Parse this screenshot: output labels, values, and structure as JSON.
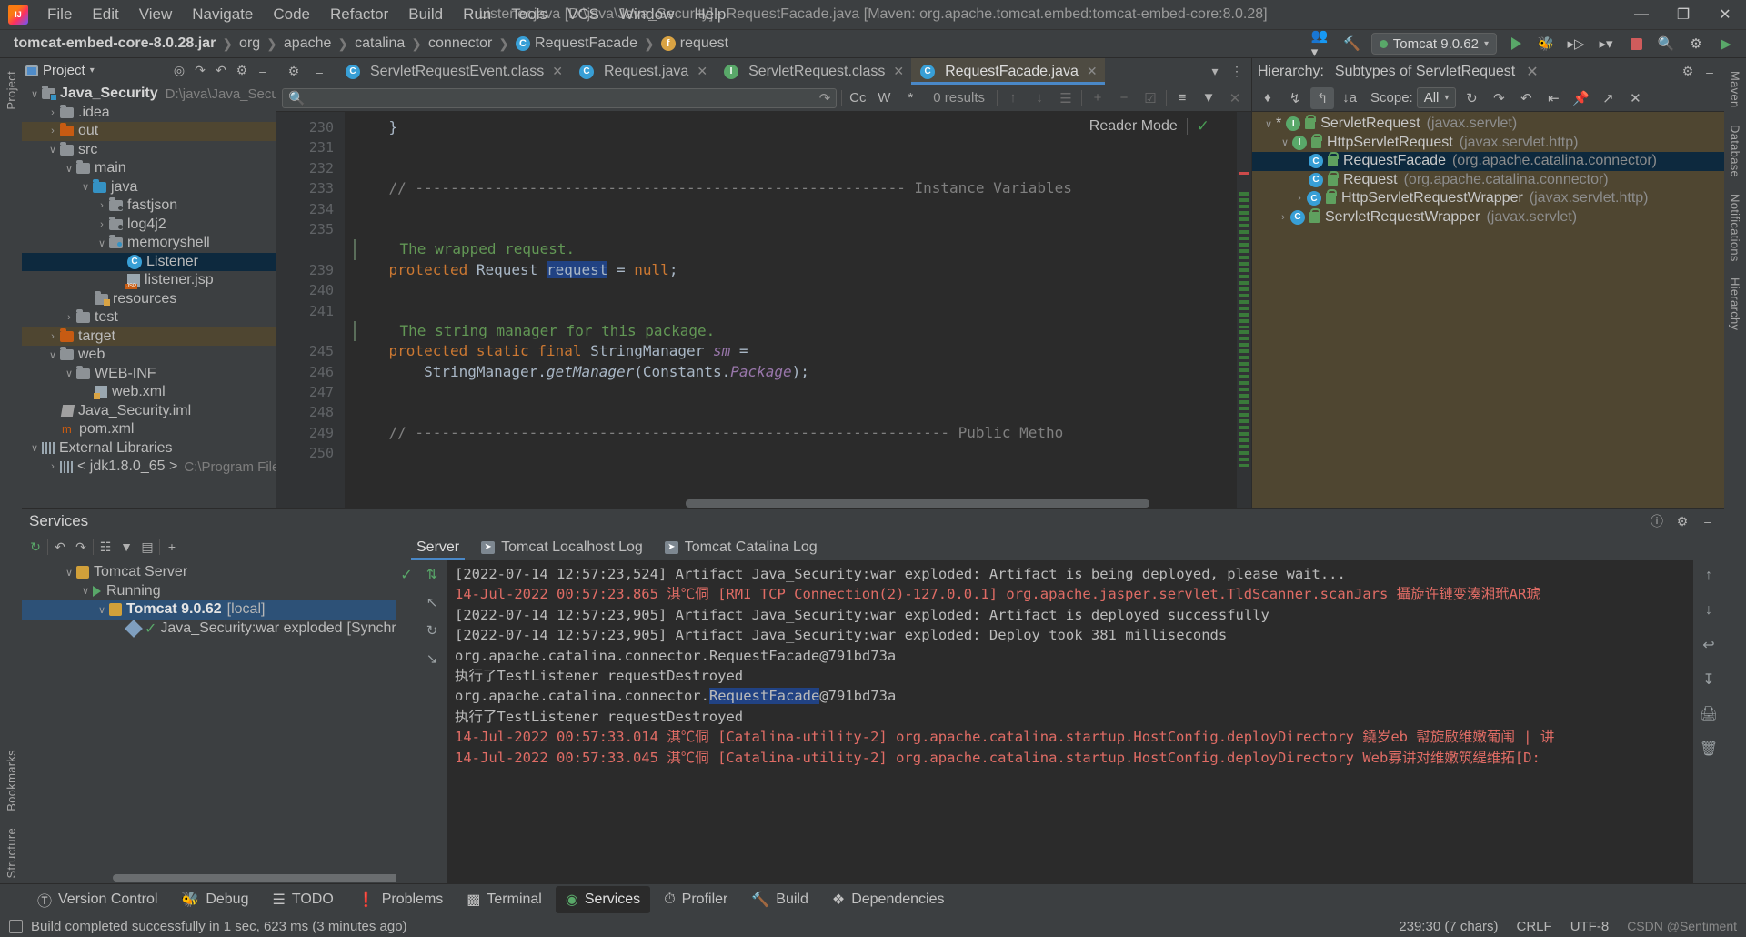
{
  "window": {
    "title": "Listener.java [D:\\java\\Java_Security] - RequestFacade.java [Maven: org.apache.tomcat.embed:tomcat-embed-core:8.0.28]",
    "menu": [
      "File",
      "Edit",
      "View",
      "Navigate",
      "Code",
      "Refactor",
      "Build",
      "Run",
      "Tools",
      "VCS",
      "Window",
      "Help"
    ],
    "controls": {
      "minimize": "—",
      "maximize": "❐",
      "close": "✕"
    },
    "logo": "intellij-idea-logo"
  },
  "navbar": {
    "crumbs": [
      {
        "label": "tomcat-embed-core-8.0.28.jar",
        "icon": "",
        "bold": true
      },
      {
        "label": "org",
        "icon": ""
      },
      {
        "label": "apache",
        "icon": ""
      },
      {
        "label": "catalina",
        "icon": ""
      },
      {
        "label": "connector",
        "icon": ""
      },
      {
        "label": "RequestFacade",
        "icon": "C"
      },
      {
        "label": "request",
        "icon": "f"
      }
    ],
    "run_config": "Tomcat 9.0.62",
    "icons": [
      "user-group-icon",
      "hammer-build-icon",
      "run-icon",
      "debug-icon",
      "run-with-coverage-icon",
      "profiler-icon",
      "stop-icon",
      "search-icon",
      "settings-icon",
      "updates-icon"
    ]
  },
  "project_panel": {
    "title": "Project",
    "toolbar_icons": [
      "locate-icon",
      "expand-all-icon",
      "collapse-all-icon",
      "settings-icon",
      "hide-icon"
    ],
    "tree": [
      {
        "depth": 0,
        "arrow": "∨",
        "icon": "module-folder",
        "label": "Java_Security",
        "bold": true,
        "path": "D:\\java\\Java_Security"
      },
      {
        "depth": 1,
        "arrow": "›",
        "icon": "folder",
        "label": ".idea"
      },
      {
        "depth": 1,
        "arrow": "›",
        "icon": "folder-orange",
        "label": "out",
        "highlight": "excluded"
      },
      {
        "depth": 1,
        "arrow": "∨",
        "icon": "folder",
        "label": "src"
      },
      {
        "depth": 2,
        "arrow": "∨",
        "icon": "folder",
        "label": "main"
      },
      {
        "depth": 3,
        "arrow": "∨",
        "icon": "folder-source",
        "label": "java"
      },
      {
        "depth": 4,
        "arrow": "›",
        "icon": "package",
        "label": "fastjson"
      },
      {
        "depth": 4,
        "arrow": "›",
        "icon": "package",
        "label": "log4j2"
      },
      {
        "depth": 4,
        "arrow": "∨",
        "icon": "package",
        "label": "memoryshell"
      },
      {
        "depth": 5,
        "arrow": "",
        "icon": "class",
        "label": "Listener",
        "selected": true
      },
      {
        "depth": 5,
        "arrow": "",
        "icon": "jsp",
        "label": "listener.jsp"
      },
      {
        "depth": 3,
        "arrow": "",
        "icon": "folder-resources",
        "label": "resources"
      },
      {
        "depth": 2,
        "arrow": "›",
        "icon": "folder",
        "label": "test"
      },
      {
        "depth": 1,
        "arrow": "›",
        "icon": "folder-orange",
        "label": "target",
        "highlight": "excluded"
      },
      {
        "depth": 1,
        "arrow": "∨",
        "icon": "folder",
        "label": "web"
      },
      {
        "depth": 2,
        "arrow": "∨",
        "icon": "folder",
        "label": "WEB-INF"
      },
      {
        "depth": 3,
        "arrow": "",
        "icon": "xml",
        "label": "web.xml"
      },
      {
        "depth": 1,
        "arrow": "",
        "icon": "iml",
        "label": "Java_Security.iml"
      },
      {
        "depth": 1,
        "arrow": "",
        "icon": "maven",
        "label": "pom.xml"
      },
      {
        "depth": 0,
        "arrow": "∨",
        "icon": "libraries",
        "label": "External Libraries"
      },
      {
        "depth": 1,
        "arrow": "›",
        "icon": "jdk",
        "label": "< jdk1.8.0_65 >",
        "path": "C:\\Program Files\\Jav"
      }
    ]
  },
  "editor": {
    "tabs": [
      {
        "label": "ServletRequestEvent.class",
        "icon": "C",
        "kind": "class",
        "active": false
      },
      {
        "label": "Request.java",
        "icon": "C",
        "kind": "class",
        "active": false
      },
      {
        "label": "ServletRequest.class",
        "icon": "I",
        "kind": "interface",
        "active": false
      },
      {
        "label": "RequestFacade.java",
        "icon": "C",
        "kind": "class",
        "active": true
      }
    ],
    "tab_extra_icons": [
      "chevron-down-icon",
      "more-vertical-icon"
    ],
    "findbar": {
      "placeholder": "",
      "results": "0 results",
      "options": [
        "Cc",
        "W",
        "*"
      ],
      "icons": [
        "search-icon",
        "history-icon",
        "match-case-icon",
        "words-icon",
        "regex-icon",
        "prev-icon",
        "next-icon",
        "select-all-icon",
        "add-icon",
        "remove-icon",
        "toggle-icon",
        "filter-lines-icon",
        "filter-icon",
        "close-icon"
      ]
    },
    "reader_mode": "Reader Mode",
    "lines": [
      {
        "num": "230",
        "segments": [
          {
            "t": "    }",
            "c": "plain"
          }
        ]
      },
      {
        "num": "231",
        "segments": []
      },
      {
        "num": "232",
        "segments": []
      },
      {
        "num": "233",
        "segments": [
          {
            "t": "    // -------------------------------------------------------- Instance Variables",
            "c": "cmt"
          }
        ]
      },
      {
        "num": "234",
        "segments": []
      },
      {
        "num": "235",
        "segments": []
      },
      {
        "num": "",
        "segments": [
          {
            "t": "    The wrapped request.",
            "c": "doc"
          }
        ],
        "docbar": true
      },
      {
        "num": "239",
        "segments": [
          {
            "t": "    ",
            "c": "plain"
          },
          {
            "t": "protected",
            "c": "kw"
          },
          {
            "t": " Request ",
            "c": "plain"
          },
          {
            "t": "request",
            "c": "selfield"
          },
          {
            "t": " = ",
            "c": "plain"
          },
          {
            "t": "null",
            "c": "kw"
          },
          {
            "t": ";",
            "c": "plain"
          }
        ]
      },
      {
        "num": "240",
        "segments": []
      },
      {
        "num": "241",
        "segments": []
      },
      {
        "num": "",
        "segments": [
          {
            "t": "    The string manager for this package.",
            "c": "doc"
          }
        ],
        "docbar": true
      },
      {
        "num": "245",
        "segments": [
          {
            "t": "    ",
            "c": "plain"
          },
          {
            "t": "protected static final",
            "c": "kw"
          },
          {
            "t": " StringManager ",
            "c": "plain"
          },
          {
            "t": "sm",
            "c": "sfld"
          },
          {
            "t": " =",
            "c": "plain"
          }
        ]
      },
      {
        "num": "246",
        "segments": [
          {
            "t": "        StringManager.",
            "c": "plain"
          },
          {
            "t": "getManager",
            "c": "static"
          },
          {
            "t": "(Constants.",
            "c": "plain"
          },
          {
            "t": "Package",
            "c": "sfld"
          },
          {
            "t": ");",
            "c": "plain"
          }
        ]
      },
      {
        "num": "247",
        "segments": []
      },
      {
        "num": "248",
        "segments": []
      },
      {
        "num": "249",
        "segments": [
          {
            "t": "    // ------------------------------------------------------------- Public Metho",
            "c": "cmt"
          }
        ]
      },
      {
        "num": "250",
        "segments": []
      }
    ]
  },
  "hierarchy": {
    "label": "Hierarchy:",
    "subtitle": "Subtypes of ServletRequest",
    "scope_label": "Scope:",
    "scope_value": "All",
    "toolbar_icons": [
      "supertypes-icon",
      "subtypes-icon",
      "class-hierarchy-icon",
      "sort-alpha-icon",
      "refresh-icon",
      "expand-all-icon",
      "collapse-all-icon",
      "export-icon",
      "pin-icon",
      "open-in-editor-icon",
      "close-icon"
    ],
    "head_icons": [
      "settings-icon",
      "hide-icon"
    ],
    "tree": [
      {
        "depth": 0,
        "arrow": "∨",
        "star": true,
        "kind": "I",
        "name": "ServletRequest",
        "pkg": "(javax.servlet)"
      },
      {
        "depth": 1,
        "arrow": "∨",
        "star": false,
        "kind": "I",
        "name": "HttpServletRequest",
        "pkg": "(javax.servlet.http)"
      },
      {
        "depth": 2,
        "arrow": "",
        "star": false,
        "kind": "C",
        "name": "RequestFacade",
        "pkg": "(org.apache.catalina.connector)",
        "selected": true
      },
      {
        "depth": 2,
        "arrow": "",
        "star": false,
        "kind": "C",
        "name": "Request",
        "pkg": "(org.apache.catalina.connector)"
      },
      {
        "depth": 1,
        "arrow": "›",
        "star": false,
        "kind": "C",
        "name": "HttpServletRequestWrapper",
        "pkg": "(javax.servlet.http)"
      },
      {
        "depth": 0,
        "arrow": "›",
        "star": false,
        "kind": "C",
        "name": "ServletRequestWrapper",
        "pkg": "(javax.servlet)"
      }
    ]
  },
  "services": {
    "title": "Services",
    "head_icons": [
      "help-icon",
      "settings-icon",
      "hide-icon"
    ],
    "toolbar_icons": [
      "rerun-icon",
      "collapse-all-icon",
      "expand-all-icon",
      "group-icon",
      "filter-icon",
      "show-icon",
      "add-icon"
    ],
    "tree": [
      {
        "depth": 0,
        "arrow": "∨",
        "icon": "tomcat-server",
        "label": "Tomcat Server"
      },
      {
        "depth": 1,
        "arrow": "∨",
        "icon": "running",
        "label": "Running"
      },
      {
        "depth": 2,
        "arrow": "∨",
        "icon": "tomcat",
        "label": "Tomcat 9.0.62",
        "suffix": "[local]",
        "selected": true,
        "bold": true
      },
      {
        "depth": 3,
        "arrow": "",
        "icon": "war",
        "label": "Java_Security:war exploded",
        "suffix": "[Synchronized"
      }
    ],
    "tabs": [
      {
        "label": "Server",
        "icon": "",
        "active": true
      },
      {
        "label": "Tomcat Localhost Log",
        "icon": "log",
        "active": false
      },
      {
        "label": "Tomcat Catalina Log",
        "icon": "log",
        "active": false
      }
    ],
    "console_tools": [
      "rerun-icon",
      "scroll-to-end-icon",
      "up-icon",
      "restart-icon",
      "down-icon"
    ],
    "console_right_tools": [
      "scroll-up-icon",
      "scroll-down-icon",
      "soft-wrap-icon",
      "scroll-to-end-icon",
      "print-icon",
      "clear-all-icon"
    ],
    "console_lines": [
      {
        "text": "[2022-07-14 12:57:23,524] Artifact Java_Security:war exploded: Artifact is being deployed, please wait...",
        "err": false
      },
      {
        "text": "14-Jul-2022 00:57:23.865 淇℃侗 [RMI TCP Connection(2)-127.0.0.1] org.apache.jasper.servlet.TldScanner.scanJars 攝旋许鏈变湊湘玳AR琥",
        "err": true
      },
      {
        "text": "[2022-07-14 12:57:23,905] Artifact Java_Security:war exploded: Artifact is deployed successfully",
        "err": false
      },
      {
        "text": "[2022-07-14 12:57:23,905] Artifact Java_Security:war exploded: Deploy took 381 milliseconds",
        "err": false
      },
      {
        "text": "org.apache.catalina.connector.RequestFacade@791bd73a",
        "err": false
      },
      {
        "text": "执行了TestListener requestDestroyed",
        "err": false
      },
      {
        "text": "org.apache.catalina.connector.RequestFacade@791bd73a",
        "err": false,
        "highlight": "RequestFacade"
      },
      {
        "text": "执行了TestListener requestDestroyed",
        "err": false
      },
      {
        "text": "14-Jul-2022 00:57:33.014 淇℃侗 [Catalina-utility-2] org.apache.catalina.startup.HostConfig.deployDirectory 鐃岁eb 幇旋敐维嫩葡闱 | 讲",
        "err": true
      },
      {
        "text": "14-Jul-2022 00:57:33.045 淇℃侗 [Catalina-utility-2] org.apache.catalina.startup.HostConfig.deployDirectory Web寡讲对维嫩筑缇维拓[D:",
        "err": true
      }
    ]
  },
  "bottom_bar": {
    "tabs": [
      {
        "label": "Version Control",
        "icon": "branch-icon",
        "active": false
      },
      {
        "label": "Debug",
        "icon": "bug-icon",
        "active": false
      },
      {
        "label": "TODO",
        "icon": "list-icon",
        "active": false
      },
      {
        "label": "Problems",
        "icon": "warning-icon",
        "active": false
      },
      {
        "label": "Terminal",
        "icon": "terminal-icon",
        "active": false
      },
      {
        "label": "Services",
        "icon": "services-icon",
        "active": true
      },
      {
        "label": "Profiler",
        "icon": "profiler-icon",
        "active": false
      },
      {
        "label": "Build",
        "icon": "hammer-icon",
        "active": false
      },
      {
        "label": "Dependencies",
        "icon": "dependencies-icon",
        "active": false
      }
    ]
  },
  "status_bar": {
    "message": "Build completed successfully in 1 sec, 623 ms (3 minutes ago)",
    "caret": "239:30 (7 chars)",
    "line_separator": "CRLF",
    "encoding": "UTF-8",
    "watermark": "CSDN @Sentiment"
  },
  "left_strip": [
    "Project",
    "Structure",
    "Bookmarks"
  ],
  "right_strip": [
    "Maven",
    "Database",
    "Notifications",
    "Hierarchy"
  ],
  "colors": {
    "accent": "#4a88c7",
    "selection": "#0d293e",
    "excluded": "#4f4631",
    "error": "#e06c65",
    "success": "#59a869"
  }
}
